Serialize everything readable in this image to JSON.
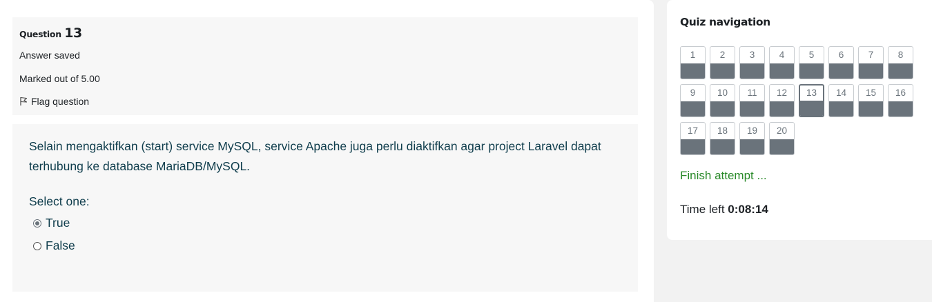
{
  "question": {
    "label": "Question",
    "number": "13",
    "state": "Answer saved",
    "grade": "Marked out of 5.00",
    "flag_label": "Flag question",
    "text": "Selain mengaktifkan (start) service MySQL, service Apache juga perlu diaktifkan agar project Laravel dapat terhubung ke database MariaDB/MySQL.",
    "prompt": "Select one:",
    "options": [
      {
        "label": "True",
        "selected": true
      },
      {
        "label": "False",
        "selected": false
      }
    ]
  },
  "nav": {
    "title": "Quiz navigation",
    "current": 13,
    "buttons": [
      "1",
      "2",
      "3",
      "4",
      "5",
      "6",
      "7",
      "8",
      "9",
      "10",
      "11",
      "12",
      "13",
      "14",
      "15",
      "16",
      "17",
      "18",
      "19",
      "20"
    ],
    "finish_label": "Finish attempt ...",
    "time_label": "Time left",
    "time_value": "0:08:14"
  },
  "colors": {
    "answered_fill": "#6a737b",
    "finish_link": "#2a8a2a",
    "question_text": "#0f3d4c"
  }
}
